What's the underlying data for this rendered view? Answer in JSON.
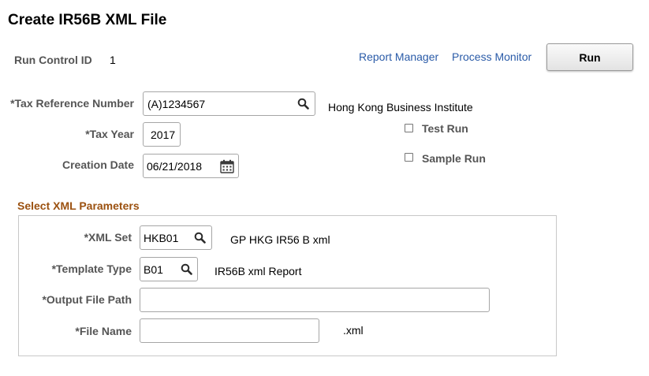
{
  "page": {
    "title": "Create IR56B XML File"
  },
  "header": {
    "run_control_label": "Run Control ID",
    "run_control_value": "1",
    "report_manager": "Report Manager",
    "process_monitor": "Process Monitor",
    "run_button": "Run"
  },
  "form": {
    "tax_ref_label": "*Tax Reference Number",
    "tax_ref_value": "(A)1234567",
    "tax_ref_desc": "Hong Kong Business Institute",
    "tax_year_label": "*Tax Year",
    "tax_year_value": "2017",
    "creation_date_label": "Creation Date",
    "creation_date_value": "06/21/2018",
    "test_run_label": "Test Run",
    "test_run_checked": false,
    "sample_run_label": "Sample Run",
    "sample_run_checked": false
  },
  "xml_params": {
    "section_title": "Select XML Parameters",
    "xml_set_label": "*XML Set",
    "xml_set_value": "HKB01",
    "xml_set_desc": "GP HKG IR56 B xml",
    "template_type_label": "*Template Type",
    "template_type_value": "B01",
    "template_type_desc": "IR56B xml Report",
    "output_path_label": "*Output File Path",
    "output_path_value": "",
    "file_name_label": "*File Name",
    "file_name_value": "",
    "file_ext": ".xml"
  },
  "icons": {
    "lookup": "search-icon",
    "calendar": "calendar-icon"
  }
}
